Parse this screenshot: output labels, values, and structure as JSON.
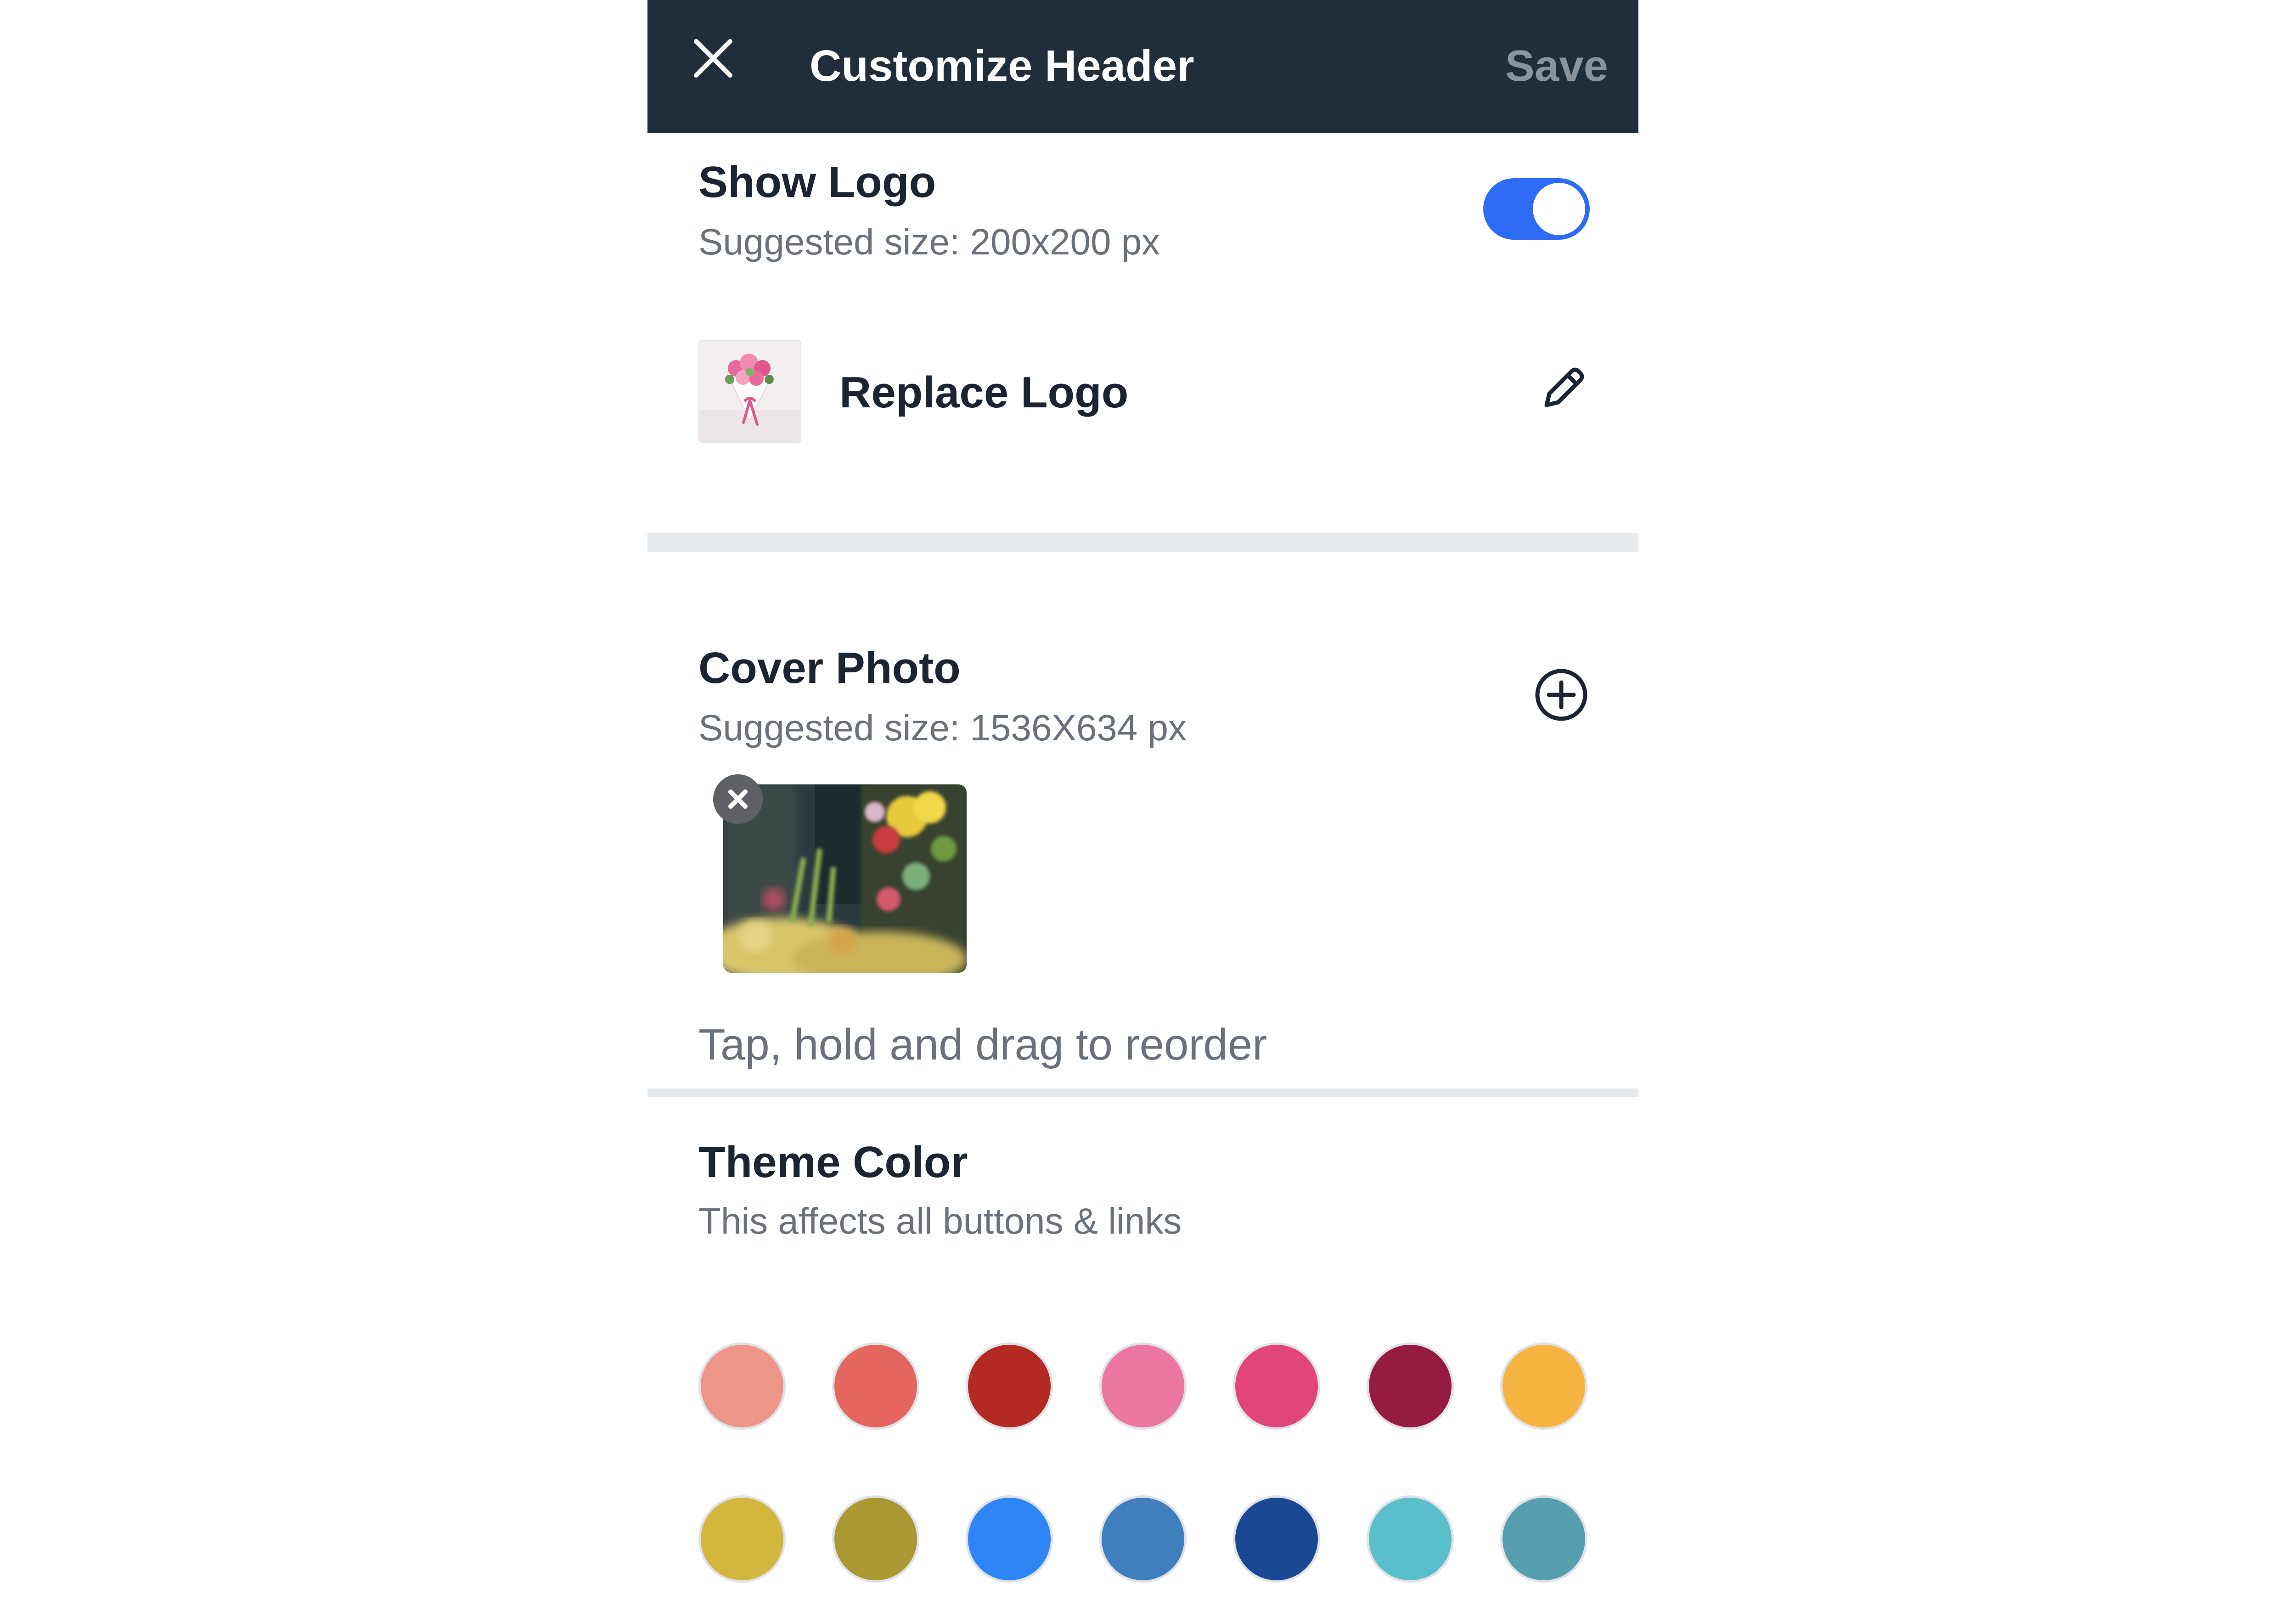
{
  "topbar": {
    "title": "Customize Header",
    "save_label": "Save",
    "close_icon": "close-icon"
  },
  "show_logo": {
    "title": "Show Logo",
    "subtitle": "Suggested size: 200x200 px",
    "toggle_on": true,
    "toggle_color": "#2f6cf5"
  },
  "replace_logo": {
    "label": "Replace Logo",
    "thumbnail": "flower-bouquet-logo-thumbnail",
    "icon": "pencil-icon"
  },
  "cover_photo": {
    "title": "Cover Photo",
    "subtitle": "Suggested size: 1536X634 px",
    "add_icon": "plus-circle-icon",
    "photos": [
      {
        "name": "flower-shop-photo",
        "remove_icon": "close-icon"
      }
    ],
    "hint": "Tap, hold and drag to reorder"
  },
  "theme_color": {
    "title": "Theme Color",
    "subtitle": "This affects all buttons & links",
    "swatches": [
      [
        "#ee958a",
        "#e5665f",
        "#b32a23",
        "#eb77a1",
        "#e2457a",
        "#951c40",
        "#f5b43f"
      ],
      [
        "#d1b73e",
        "#ab9832",
        "#2f85f5",
        "#417ebe",
        "#1a4994",
        "#5bbecb",
        "#579fae"
      ]
    ]
  }
}
